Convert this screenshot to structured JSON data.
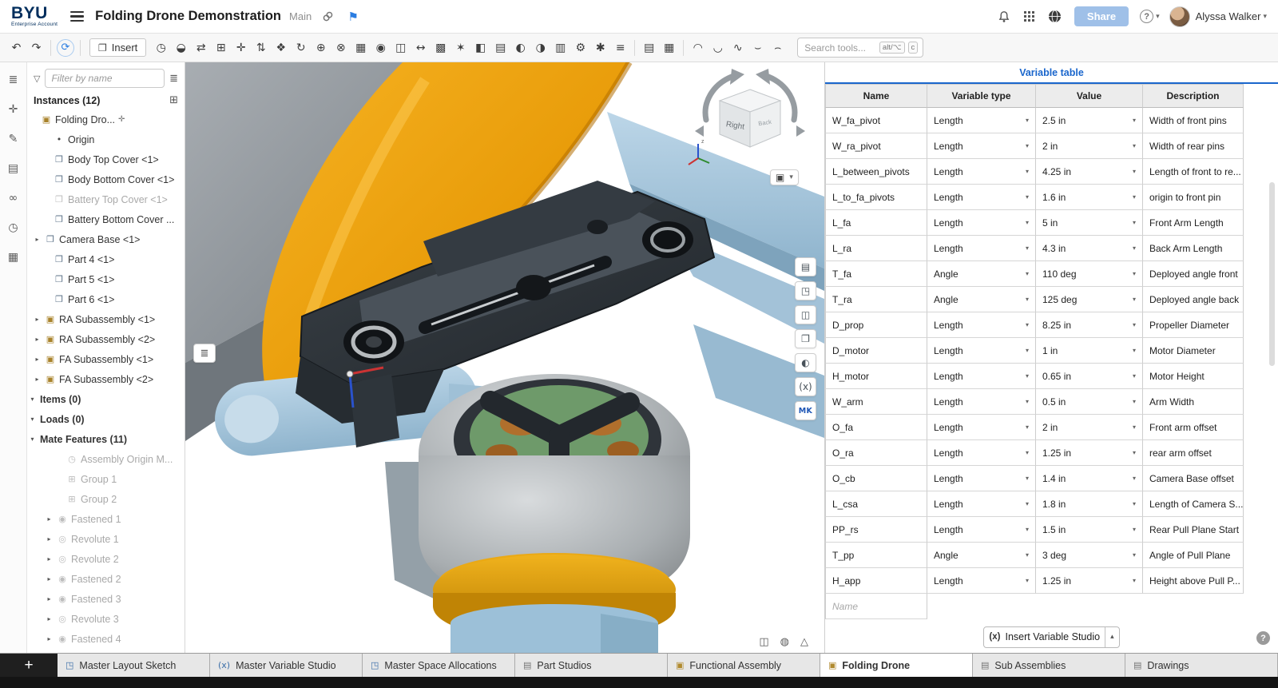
{
  "header": {
    "logo": "BYU",
    "logo_sub": "Enterprise Account",
    "title": "Folding Drone Demonstration",
    "workspace": "Main",
    "share_label": "Share",
    "user_name": "Alyssa Walker"
  },
  "toolbar": {
    "insert_label": "Insert",
    "insert_glyph": "❐",
    "search_placeholder": "Search tools...",
    "shortcut_alt": "alt/⌥",
    "shortcut_key": "c",
    "left_items": [
      {
        "name": "undo-icon",
        "glyph": "↶",
        "inter": "true"
      },
      {
        "name": "redo-icon",
        "glyph": "↷",
        "inter": "true"
      },
      {
        "name": "toolbar-separator",
        "glyph": "",
        "sep": true,
        "inter": "false"
      },
      {
        "name": "sync-icon",
        "glyph": "⟳",
        "accent": true,
        "inter": "true"
      },
      {
        "name": "toolbar-separator",
        "glyph": "",
        "sep": true,
        "inter": "false"
      }
    ],
    "right_items": [
      {
        "name": "named-positions-icon",
        "glyph": "◷",
        "inter": "true"
      },
      {
        "name": "revolve-icon",
        "glyph": "◒",
        "inter": "true"
      },
      {
        "name": "mate-icon",
        "glyph": "⇄",
        "inter": "true"
      },
      {
        "name": "group-icon",
        "glyph": "⊞",
        "inter": "true"
      },
      {
        "name": "mate-connector-icon",
        "glyph": "✛",
        "inter": "true"
      },
      {
        "name": "snap-mode-icon",
        "glyph": "⇅",
        "inter": "true"
      },
      {
        "name": "tangent-mate-icon",
        "glyph": "❖",
        "inter": "true"
      },
      {
        "name": "revolute-tool-icon",
        "glyph": "↻",
        "inter": "true"
      },
      {
        "name": "center-mate-icon",
        "glyph": "⊕",
        "inter": "true"
      },
      {
        "name": "parallel-mate-icon",
        "glyph": "⊗",
        "inter": "true"
      },
      {
        "name": "linear-pattern-icon",
        "glyph": "▦",
        "inter": "true"
      },
      {
        "name": "circular-pattern-icon",
        "glyph": "◉",
        "inter": "true"
      },
      {
        "name": "replicate-icon",
        "glyph": "◫",
        "inter": "true"
      },
      {
        "name": "measure-icon",
        "glyph": "↔",
        "inter": "true"
      },
      {
        "name": "pattern-icon",
        "glyph": "▩",
        "inter": "true"
      },
      {
        "name": "explode-icon",
        "glyph": "✶",
        "inter": "true"
      },
      {
        "name": "section-view-icon",
        "glyph": "◧",
        "inter": "true"
      },
      {
        "name": "named-views-icon",
        "glyph": "▤",
        "inter": "true"
      },
      {
        "name": "appearance-icon",
        "glyph": "◐",
        "inter": "true"
      },
      {
        "name": "display-states-icon",
        "glyph": "◑",
        "inter": "true"
      },
      {
        "name": "bom-icon",
        "glyph": "▥",
        "inter": "true"
      },
      {
        "name": "settings-icon",
        "glyph": "⚙",
        "inter": "true"
      },
      {
        "name": "simulation-icon",
        "glyph": "✱",
        "inter": "true"
      },
      {
        "name": "frame-icon",
        "glyph": "≡",
        "inter": "true"
      },
      {
        "name": "toolbar-separator",
        "glyph": "",
        "sep": true,
        "inter": "false"
      },
      {
        "name": "notes-icon",
        "glyph": "▤",
        "inter": "true"
      },
      {
        "name": "bom-table-icon",
        "glyph": "▦",
        "inter": "true"
      },
      {
        "name": "toolbar-separator",
        "glyph": "",
        "sep": true,
        "inter": "false"
      },
      {
        "name": "surface-loop-icon",
        "glyph": "◠",
        "inter": "true"
      },
      {
        "name": "surface-loop-2-icon",
        "glyph": "◡",
        "inter": "true"
      },
      {
        "name": "surface-wave-icon",
        "glyph": "∿",
        "inter": "true"
      },
      {
        "name": "surface-smile-icon",
        "glyph": "⌣",
        "inter": "true"
      },
      {
        "name": "surface-frown-icon",
        "glyph": "⌢",
        "inter": "true"
      }
    ]
  },
  "left_strip": {
    "items": [
      {
        "name": "structure-panel-icon",
        "glyph": "≣"
      },
      {
        "name": "mate-panel-icon",
        "glyph": "✛"
      },
      {
        "name": "comments-panel-icon",
        "glyph": "✎"
      },
      {
        "name": "feature-list-panel-icon",
        "glyph": "▤"
      },
      {
        "name": "connections-panel-icon",
        "glyph": "∞"
      },
      {
        "name": "history-panel-icon",
        "glyph": "◷"
      },
      {
        "name": "configurations-panel-icon",
        "glyph": "▦"
      }
    ]
  },
  "left_panel": {
    "filter_placeholder": "Filter by name",
    "instances_label": "Instances (12)",
    "tree": [
      {
        "label": "Folding Dro...",
        "icon": "assembly-icon",
        "glyph": "▣",
        "chev": "",
        "pad": "2px",
        "suffix": "✛"
      },
      {
        "label": "Origin",
        "icon": "origin-icon",
        "glyph": "•",
        "chev": "",
        "pad": "18px"
      },
      {
        "label": "Body Top Cover <1>",
        "icon": "part-icon",
        "glyph": "❐",
        "chev": "",
        "pad": "18px"
      },
      {
        "label": "Body Bottom Cover <1>",
        "icon": "part-icon",
        "glyph": "❐",
        "chev": "",
        "pad": "18px"
      },
      {
        "label": "Battery Top Cover <1>",
        "icon": "part-icon",
        "glyph": "❐",
        "chev": "",
        "pad": "18px",
        "gray": true
      },
      {
        "label": "Battery Bottom Cover ...",
        "icon": "part-icon",
        "glyph": "❐",
        "chev": "",
        "pad": "18px"
      },
      {
        "label": "Camera Base <1>",
        "icon": "part-icon",
        "glyph": "❐",
        "chev": "▸",
        "pad": "7px"
      },
      {
        "label": "Part 4 <1>",
        "icon": "part-icon",
        "glyph": "❐",
        "chev": "",
        "pad": "18px"
      },
      {
        "label": "Part 5 <1>",
        "icon": "part-icon",
        "glyph": "❐",
        "chev": "",
        "pad": "18px"
      },
      {
        "label": "Part 6 <1>",
        "icon": "part-icon",
        "glyph": "❐",
        "chev": "",
        "pad": "18px"
      },
      {
        "label": "RA Subassembly <1>",
        "icon": "assembly-icon",
        "glyph": "▣",
        "chev": "▸",
        "pad": "7px"
      },
      {
        "label": "RA Subassembly <2>",
        "icon": "assembly-icon",
        "glyph": "▣",
        "chev": "▸",
        "pad": "7px"
      },
      {
        "label": "FA Subassembly <1>",
        "icon": "assembly-icon",
        "glyph": "▣",
        "chev": "▸",
        "pad": "7px"
      },
      {
        "label": "FA Subassembly <2>",
        "icon": "assembly-icon",
        "glyph": "▣",
        "chev": "▸",
        "pad": "7px"
      },
      {
        "label": "Items (0)",
        "icon": "",
        "glyph": "",
        "chev": "▾",
        "pad": "1px",
        "section": true
      },
      {
        "label": "Loads (0)",
        "icon": "",
        "glyph": "",
        "chev": "▾",
        "pad": "1px",
        "section": true
      },
      {
        "label": "Mate Features (11)",
        "icon": "",
        "glyph": "",
        "chev": "▾",
        "pad": "1px",
        "section": true
      },
      {
        "label": "Assembly Origin M...",
        "icon": "mate-origin-icon",
        "glyph": "◷",
        "chev": "",
        "pad": "34px",
        "gray": true
      },
      {
        "label": "Group 1",
        "icon": "group-mate-icon",
        "glyph": "⊞",
        "chev": "",
        "pad": "34px",
        "gray": true
      },
      {
        "label": "Group 2",
        "icon": "group-mate-icon",
        "glyph": "⊞",
        "chev": "",
        "pad": "34px",
        "gray": true
      },
      {
        "label": "Fastened 1",
        "icon": "fastened-mate-icon",
        "glyph": "◉",
        "chev": "▸",
        "pad": "22px",
        "gray": true
      },
      {
        "label": "Revolute 1",
        "icon": "revolute-mate-icon",
        "glyph": "◎",
        "chev": "▸",
        "pad": "22px",
        "gray": true
      },
      {
        "label": "Revolute 2",
        "icon": "revolute-mate-icon",
        "glyph": "◎",
        "chev": "▸",
        "pad": "22px",
        "gray": true
      },
      {
        "label": "Fastened 2",
        "icon": "fastened-mate-icon",
        "glyph": "◉",
        "chev": "▸",
        "pad": "22px",
        "gray": true
      },
      {
        "label": "Fastened 3",
        "icon": "fastened-mate-icon",
        "glyph": "◉",
        "chev": "▸",
        "pad": "22px",
        "gray": true
      },
      {
        "label": "Revolute 3",
        "icon": "revolute-mate-icon",
        "glyph": "◎",
        "chev": "▸",
        "pad": "22px",
        "gray": true
      },
      {
        "label": "Fastened 4",
        "icon": "fastened-mate-icon",
        "glyph": "◉",
        "chev": "▸",
        "pad": "22px",
        "gray": true
      }
    ]
  },
  "viewport": {
    "cube_front": "Right",
    "cube_side": "Back",
    "view_menu_glyph": "▣",
    "list_button_glyph": "≣",
    "stack": [
      {
        "name": "sheet-tool-icon",
        "glyph": "▤"
      },
      {
        "name": "parts-list-tool-icon",
        "glyph": "◳"
      },
      {
        "name": "link-tool-icon",
        "glyph": "◫"
      },
      {
        "name": "drawing-tool-icon",
        "glyph": "❐"
      },
      {
        "name": "appearance-tool-icon",
        "glyph": "◐"
      },
      {
        "name": "variable-tool-icon",
        "glyph": "(x)"
      },
      {
        "name": "mk-plugin-icon",
        "glyph": "MK",
        "accent": true
      }
    ],
    "corner_tools": [
      {
        "name": "snapshot-icon",
        "glyph": "◫"
      },
      {
        "name": "globe-view-icon",
        "glyph": "◍"
      },
      {
        "name": "scale-icon",
        "glyph": "△"
      }
    ]
  },
  "variable_table": {
    "title": "Variable table",
    "columns": [
      "Name",
      "Variable type",
      "Value",
      "Description"
    ],
    "rows": [
      {
        "name": "W_fa_pivot",
        "type": "Length",
        "value": "2.5 in",
        "desc": "Width of front pins"
      },
      {
        "name": "W_ra_pivot",
        "type": "Length",
        "value": "2 in",
        "desc": "Width of rear pins"
      },
      {
        "name": "L_between_pivots",
        "type": "Length",
        "value": "4.25 in",
        "desc": "Length of front to re..."
      },
      {
        "name": "L_to_fa_pivots",
        "type": "Length",
        "value": "1.6 in",
        "desc": "origin to front pin"
      },
      {
        "name": "L_fa",
        "type": "Length",
        "value": "5 in",
        "desc": "Front Arm Length"
      },
      {
        "name": "L_ra",
        "type": "Length",
        "value": "4.3 in",
        "desc": "Back Arm Length"
      },
      {
        "name": "T_fa",
        "type": "Angle",
        "value": "110 deg",
        "desc": "Deployed angle front"
      },
      {
        "name": "T_ra",
        "type": "Angle",
        "value": "125 deg",
        "desc": "Deployed angle back"
      },
      {
        "name": "D_prop",
        "type": "Length",
        "value": "8.25 in",
        "desc": "Propeller Diameter"
      },
      {
        "name": "D_motor",
        "type": "Length",
        "value": "1 in",
        "desc": "Motor Diameter"
      },
      {
        "name": "H_motor",
        "type": "Length",
        "value": "0.65 in",
        "desc": "Motor Height"
      },
      {
        "name": "W_arm",
        "type": "Length",
        "value": "0.5 in",
        "desc": "Arm Width"
      },
      {
        "name": "O_fa",
        "type": "Length",
        "value": "2 in",
        "desc": "Front arm offset"
      },
      {
        "name": "O_ra",
        "type": "Length",
        "value": "1.25 in",
        "desc": "rear arm offset"
      },
      {
        "name": "O_cb",
        "type": "Length",
        "value": "1.4 in",
        "desc": "Camera Base offset"
      },
      {
        "name": "L_csa",
        "type": "Length",
        "value": "1.8 in",
        "desc": "Length of Camera S..."
      },
      {
        "name": "PP_rs",
        "type": "Length",
        "value": "1.5 in",
        "desc": "Rear Pull Plane Start"
      },
      {
        "name": "T_pp",
        "type": "Angle",
        "value": "3 deg",
        "desc": "Angle of Pull Plane"
      },
      {
        "name": "H_app",
        "type": "Length",
        "value": "1.25 in",
        "desc": "Height above Pull P..."
      }
    ],
    "new_row_placeholder": "Name",
    "insert_button_label": "Insert Variable Studio",
    "insert_button_glyph": "(x)"
  },
  "tabs": {
    "add_label": "+",
    "items": [
      {
        "label": "Master Layout Sketch",
        "icon": "part-studio-tab-icon",
        "glyph": "◳",
        "color": "#3a6ea8"
      },
      {
        "label": "Master Variable Studio",
        "icon": "variable-studio-tab-icon",
        "glyph": "(x)",
        "color": "#3a6ea8"
      },
      {
        "label": "Master Space Allocations",
        "icon": "part-studio-tab-icon",
        "glyph": "◳",
        "color": "#3a6ea8"
      },
      {
        "label": "Part Studios",
        "icon": "folder-tab-icon",
        "glyph": "▤",
        "color": "#757575"
      },
      {
        "label": "Functional Assembly",
        "icon": "assembly-tab-icon",
        "glyph": "▣",
        "color": "#b08a2e"
      },
      {
        "label": "Folding Drone",
        "icon": "assembly-tab-icon",
        "glyph": "▣",
        "color": "#b08a2e",
        "active": true
      },
      {
        "label": "Sub Assemblies",
        "icon": "folder-tab-icon",
        "glyph": "▤",
        "color": "#757575"
      },
      {
        "label": "Drawings",
        "icon": "folder-tab-icon",
        "glyph": "▤",
        "color": "#757575"
      }
    ]
  }
}
